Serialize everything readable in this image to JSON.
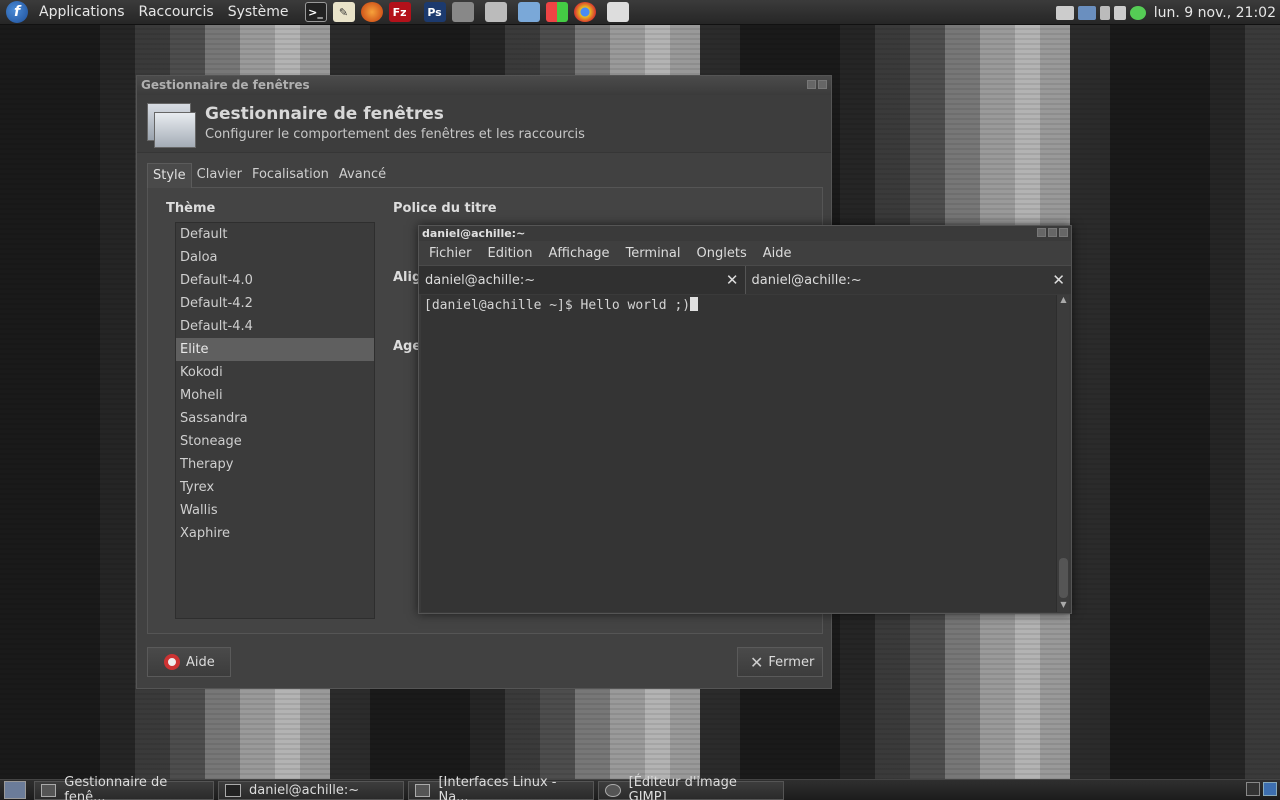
{
  "top_panel": {
    "menus": [
      "Applications",
      "Raccourcis",
      "Système"
    ],
    "clock": "lun.  9 nov., 21:02"
  },
  "wm": {
    "title": "Gestionnaire de fenêtres",
    "header_title": "Gestionnaire de fenêtres",
    "header_subtitle": "Configurer le comportement des fenêtres et les raccourcis",
    "tabs": [
      "Style",
      "Clavier",
      "Focalisation",
      "Avancé"
    ],
    "theme_label": "Thème",
    "themes": [
      "Default",
      "Daloa",
      "Default-4.0",
      "Default-4.2",
      "Default-4.4",
      "Elite",
      "Kokodi",
      "Moheli",
      "Sassandra",
      "Stoneage",
      "Therapy",
      "Tyrex",
      "Wallis",
      "Xaphire"
    ],
    "selected_theme": "Elite",
    "title_font_label": "Police du titre",
    "align_label": "Alig",
    "age_label": "Age",
    "help_button": "Aide",
    "close_button": "Fermer"
  },
  "terminal": {
    "title": "daniel@achille:~",
    "menus": [
      "Fichier",
      "Edition",
      "Affichage",
      "Terminal",
      "Onglets",
      "Aide"
    ],
    "tabs": [
      "daniel@achille:~",
      "daniel@achille:~"
    ],
    "prompt": "[daniel@achille ~]$ Hello world ;)"
  },
  "taskbar": {
    "tasks": [
      "Gestionnaire de fenê...",
      "daniel@achille:~",
      "[Interfaces Linux - Na...",
      "[Éditeur d'image GIMP]"
    ]
  }
}
